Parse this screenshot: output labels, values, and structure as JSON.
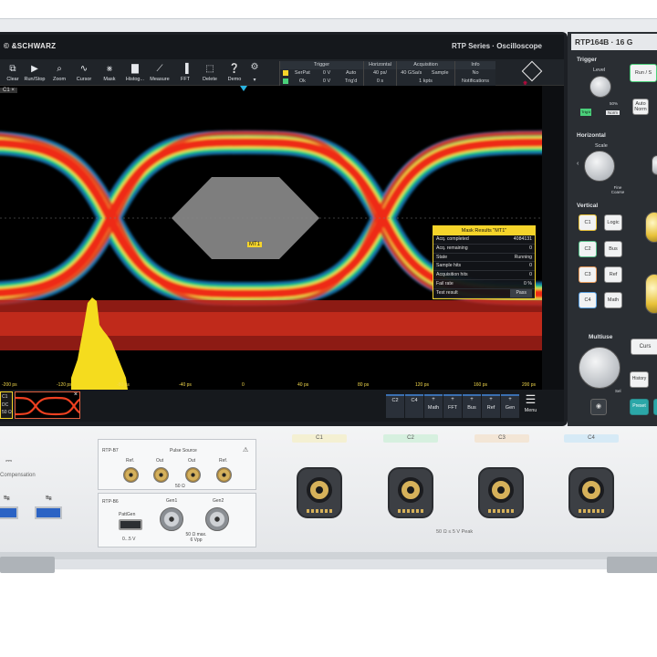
{
  "brand": "© &SCHWARZ",
  "series_title": "RTP Series · Oscilloscope",
  "toolbar": [
    {
      "icon": "clear-icon",
      "glyph": "⧉",
      "label": "Clear"
    },
    {
      "icon": "play-icon",
      "glyph": "▶",
      "label": "Run/Stop"
    },
    {
      "icon": "zoom-icon",
      "glyph": "⌕",
      "label": "Zoom"
    },
    {
      "icon": "cursor-icon",
      "glyph": "∿",
      "label": "Cursor"
    },
    {
      "icon": "mask-icon",
      "glyph": "⨳",
      "label": "Mask"
    },
    {
      "icon": "histogram-icon",
      "glyph": "▇",
      "label": "Histog..."
    },
    {
      "icon": "measure-icon",
      "glyph": "⟋",
      "label": "Measure"
    },
    {
      "icon": "fft-icon",
      "glyph": "▐",
      "label": "FFT"
    },
    {
      "icon": "delete-icon",
      "glyph": "⬚",
      "label": "Delete"
    },
    {
      "icon": "demo-icon",
      "glyph": "❔",
      "label": "Demo"
    }
  ],
  "trigger": {
    "header": "Trigger",
    "row1": [
      "SerPat",
      "0 V",
      "Auto"
    ],
    "row2": [
      "Ok",
      "0 V",
      "Trig'd"
    ]
  },
  "horizontal": {
    "header": "Horizontal",
    "row1": "40 ps/",
    "row2": "0 s"
  },
  "acquisition": {
    "header": "Acquisition",
    "row1": [
      "40 GSa/s",
      "Sample"
    ],
    "row2": "1 kpts"
  },
  "info": {
    "header": "Info",
    "row1": "No",
    "row2": "Notifications"
  },
  "channel_tag": "C1 ×",
  "mask_label": "MT1",
  "mask_results": {
    "title": "Mask Results \"MT1\"",
    "rows": [
      {
        "k": "Acq. completed",
        "v": "4084131"
      },
      {
        "k": "Acq. remaining",
        "v": "0"
      },
      {
        "k": "State",
        "v": "Running"
      },
      {
        "k": "Sample hits",
        "v": "0"
      },
      {
        "k": "Acquisition hits",
        "v": "0"
      },
      {
        "k": "Fail rate",
        "v": "0 %"
      },
      {
        "k": "Test result",
        "v": "Pass"
      }
    ]
  },
  "time_ticks": [
    "-200 ps",
    "-120 ps",
    "-80 ps",
    "-40 ps",
    "0",
    "40 ps",
    "80 ps",
    "120 ps",
    "160 ps",
    "200 ps"
  ],
  "thumbnail1": [
    "C1",
    "DC",
    "50 Ω"
  ],
  "bottom_buttons": [
    {
      "plus": "",
      "label": "C2"
    },
    {
      "plus": "",
      "label": "C4"
    },
    {
      "plus": "+",
      "label": "Math"
    },
    {
      "plus": "+",
      "label": "FFT"
    },
    {
      "plus": "+",
      "label": "Bus"
    },
    {
      "plus": "+",
      "label": "Ref"
    },
    {
      "plus": "+",
      "label": "Gen"
    }
  ],
  "menu_label": "Menu",
  "model": "RTP164B · 16 G",
  "panel": {
    "trigger_title": "Trigger",
    "level_label": "Level",
    "fifty_label": "50%",
    "run_label": "Run / S",
    "auto_norm": "Auto Norm",
    "trig_led": "Trig'd",
    "norm_label": "Norm",
    "horizontal_title": "Horizontal",
    "scale_label": "Scale",
    "fine_coarse": "Fine Coarse",
    "vertical_title": "Vertical",
    "c1": "C1",
    "c2": "C2",
    "c3": "C3",
    "c4": "C4",
    "logic": "Logic",
    "bus": "Bus",
    "ref": "Ref",
    "math": "Math",
    "multiuse_title": "Multiuse",
    "cursor_label": "Curs",
    "history_label": "History",
    "preset_label": "Preset",
    "sel_label": "Sel"
  },
  "channel_labels": [
    "C1",
    "C2",
    "C3",
    "C4"
  ],
  "probe_module": {
    "rtp_b7": "RTP-B7",
    "pulse_source": "Pulse Source",
    "ref": "Ref.",
    "out": "Out",
    "fifty_ohm": "50 Ω",
    "rtp_b6": "RTP-B6",
    "pattgen": "PattGen",
    "gen1": "Gen1",
    "gen2": "Gen2",
    "range": "0...5 V",
    "gen_spec": "50 Ω max. 6 Vpp"
  },
  "compensation": "Compensation",
  "input_warning": "50 Ω ≤ 5 V Peak"
}
